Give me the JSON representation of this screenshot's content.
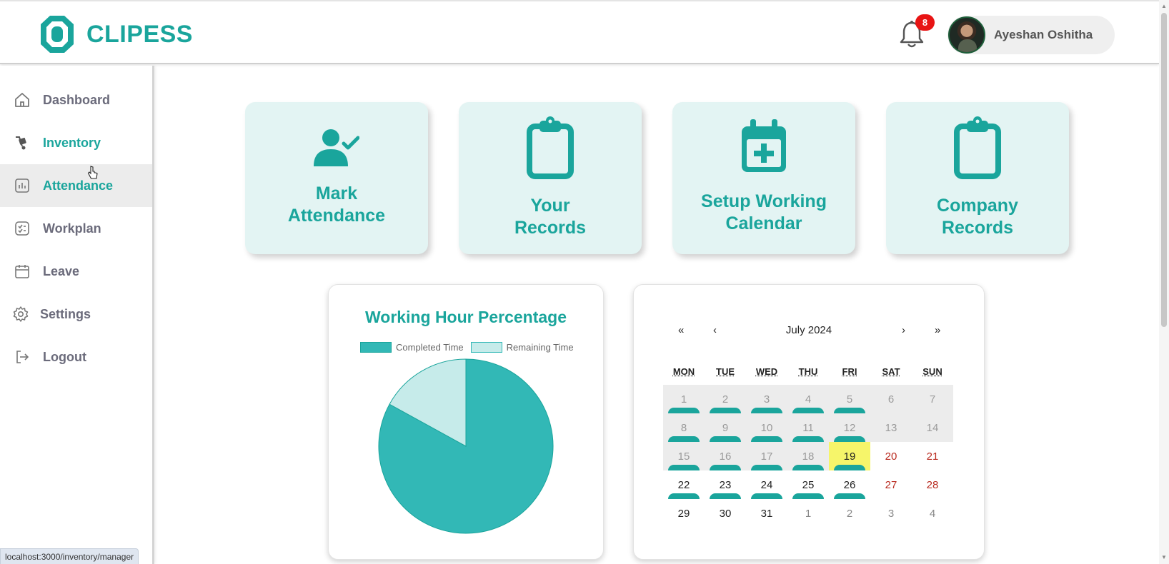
{
  "app": {
    "brand": "CLIPESS",
    "brand_color": "#1aa59c"
  },
  "header": {
    "notification_count": "8",
    "user_name": "Ayeshan Oshitha"
  },
  "sidebar": {
    "items": [
      {
        "label": "Dashboard",
        "icon": "home-icon"
      },
      {
        "label": "Inventory",
        "icon": "dolly-icon"
      },
      {
        "label": "Attendance",
        "icon": "bar-chart-icon"
      },
      {
        "label": "Workplan",
        "icon": "checklist-icon"
      },
      {
        "label": "Leave",
        "icon": "calendar-icon"
      },
      {
        "label": "Settings",
        "icon": "gear-icon"
      },
      {
        "label": "Logout",
        "icon": "logout-icon"
      }
    ]
  },
  "cards": [
    {
      "line1": "Mark",
      "line2": "Attendance",
      "icon": "user-check-icon"
    },
    {
      "line1": "Your",
      "line2": "Records",
      "icon": "clipboard-icon"
    },
    {
      "line1": "Setup Working",
      "line2": "Calendar",
      "icon": "calendar-plus-icon"
    },
    {
      "line1": "Company",
      "line2": "Records",
      "icon": "clipboard-icon"
    }
  ],
  "chart_data": {
    "type": "pie",
    "title": "Working Hour Percentage",
    "categories": [
      "Completed Time",
      "Remaining Time"
    ],
    "values": [
      83,
      17
    ],
    "colors": [
      "#32b8b6",
      "#c6ebea"
    ],
    "legend": "top"
  },
  "calendar": {
    "month_label": "July 2024",
    "nav": {
      "prev_year": "«",
      "prev_month": "‹",
      "next_month": "›",
      "next_year": "»"
    },
    "weekdays": [
      "MON",
      "TUE",
      "WED",
      "THU",
      "FRI",
      "SAT",
      "SUN"
    ],
    "weeks": [
      [
        "1",
        "2",
        "3",
        "4",
        "5",
        "6",
        "7"
      ],
      [
        "8",
        "9",
        "10",
        "11",
        "12",
        "13",
        "14"
      ],
      [
        "15",
        "16",
        "17",
        "18",
        "19",
        "20",
        "21"
      ],
      [
        "22",
        "23",
        "24",
        "25",
        "26",
        "27",
        "28"
      ],
      [
        "29",
        "30",
        "31",
        "1",
        "2",
        "3",
        "4"
      ]
    ],
    "today": "19"
  },
  "status_bar": {
    "url": "localhost:3000/inventory/manager"
  }
}
